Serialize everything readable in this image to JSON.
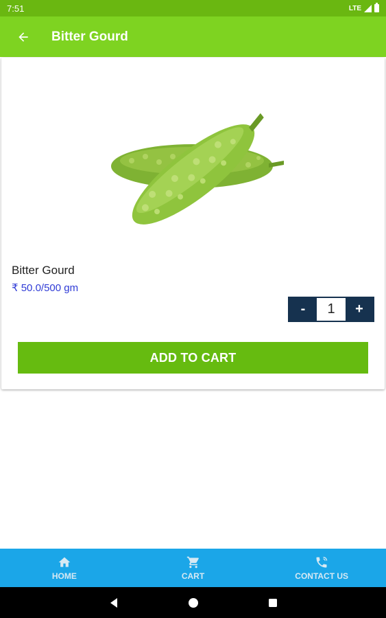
{
  "status_bar": {
    "time": "7:51",
    "network": "LTE"
  },
  "header": {
    "title": "Bitter Gourd"
  },
  "product": {
    "name": "Bitter Gourd",
    "price": "₹ 50.0/500 gm",
    "image_icon": "bitter-gourd-image"
  },
  "quantity": {
    "minus_label": "-",
    "value": "1",
    "plus_label": "+"
  },
  "actions": {
    "add_to_cart": "ADD TO CART"
  },
  "bottom_nav": {
    "items": [
      {
        "label": "HOME",
        "icon": "home-icon"
      },
      {
        "label": "CART",
        "icon": "cart-icon"
      },
      {
        "label": "CONTACT US",
        "icon": "phone-icon"
      }
    ]
  },
  "colors": {
    "status_bar": "#6ab711",
    "app_bar": "#7ed321",
    "button": "#66bb10",
    "price": "#2f3bd6",
    "stepper": "#16324f",
    "bottom_nav": "#1ba6e8"
  }
}
